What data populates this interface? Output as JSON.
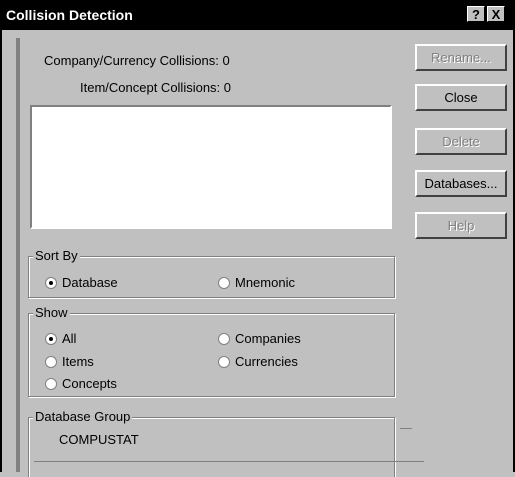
{
  "window": {
    "title": "Collision Detection",
    "help_button": "?",
    "close_button": "X"
  },
  "summary": {
    "company_currency": "Company/Currency Collisions:  0",
    "item_concept": "Item/Concept Collisions:  0"
  },
  "collision_list": [],
  "sort_by": {
    "label": "Sort By",
    "options": [
      {
        "label": "Database",
        "selected": true
      },
      {
        "label": "Mnemonic",
        "selected": false
      }
    ]
  },
  "show": {
    "label": "Show",
    "options": [
      {
        "label": "All",
        "selected": true
      },
      {
        "label": "Items",
        "selected": false
      },
      {
        "label": "Concepts",
        "selected": false
      },
      {
        "label": "Companies",
        "selected": false
      },
      {
        "label": "Currencies",
        "selected": false
      }
    ]
  },
  "database_group": {
    "label": "Database Group",
    "value": "COMPUSTAT"
  },
  "buttons": {
    "rename": "Rename...",
    "close": "Close",
    "delete": "Delete",
    "databases": "Databases...",
    "help": "Help"
  },
  "colors": {
    "face": "#c0c0c0",
    "titlebar": "#000000",
    "disabled_text": "#808080"
  }
}
